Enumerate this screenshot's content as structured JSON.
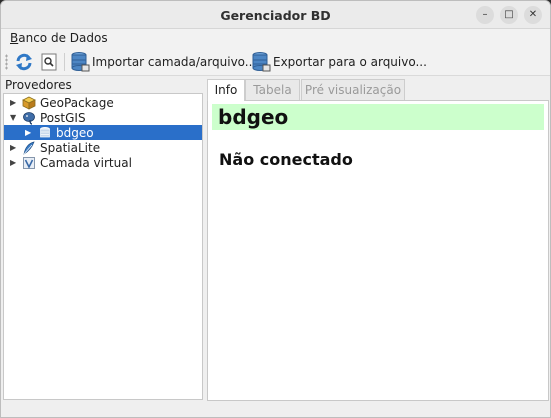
{
  "window": {
    "title": "Gerenciador BD",
    "minimize_glyph": "–",
    "maximize_glyph": "□",
    "close_glyph": "✕"
  },
  "menubar": {
    "items": [
      {
        "label_first": "B",
        "label_rest": "anco de Dados"
      }
    ]
  },
  "toolbar": {
    "import_label": "Importar camada/arquivo...",
    "export_label": "Exportar para o arquivo..."
  },
  "left_panel": {
    "title": "Provedores",
    "tree": [
      {
        "label": "GeoPackage",
        "icon": "geopackage-icon",
        "expanded": false
      },
      {
        "label": "PostGIS",
        "icon": "postgis-elephant-icon",
        "expanded": true
      },
      {
        "label": "bdgeo",
        "icon": "database-icon",
        "selected": true
      },
      {
        "label": "SpatiaLite",
        "icon": "spatialite-feather-icon",
        "expanded": false
      },
      {
        "label": "Camada virtual",
        "icon": "virtual-layer-icon",
        "expanded": false
      }
    ]
  },
  "right_panel": {
    "tabs": [
      {
        "label": "Info",
        "active": true
      },
      {
        "label": "Tabela",
        "active": false
      },
      {
        "label": "Pré visualização",
        "active": false
      }
    ],
    "info": {
      "db_name": "bdgeo",
      "status": "Não conectado"
    }
  },
  "colors": {
    "selection": "#2a6fc9",
    "header_bg": "#ccffcc",
    "window_bg": "#efefef"
  }
}
